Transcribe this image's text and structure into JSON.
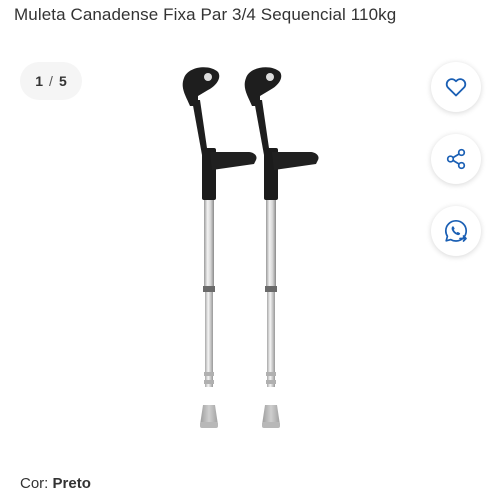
{
  "product": {
    "title": "Muleta Canadense Fixa Par 3/4 Sequencial 110kg"
  },
  "gallery": {
    "current": "1",
    "separator": "/",
    "total": "5"
  },
  "actions": {
    "favorite_icon": "heart-icon",
    "share_icon": "share-icon",
    "whatsapp_icon": "whatsapp-icon"
  },
  "variant": {
    "label": "Cor:",
    "value": "Preto"
  },
  "colors": {
    "accent": "#1a5fb4",
    "text": "#333333"
  }
}
